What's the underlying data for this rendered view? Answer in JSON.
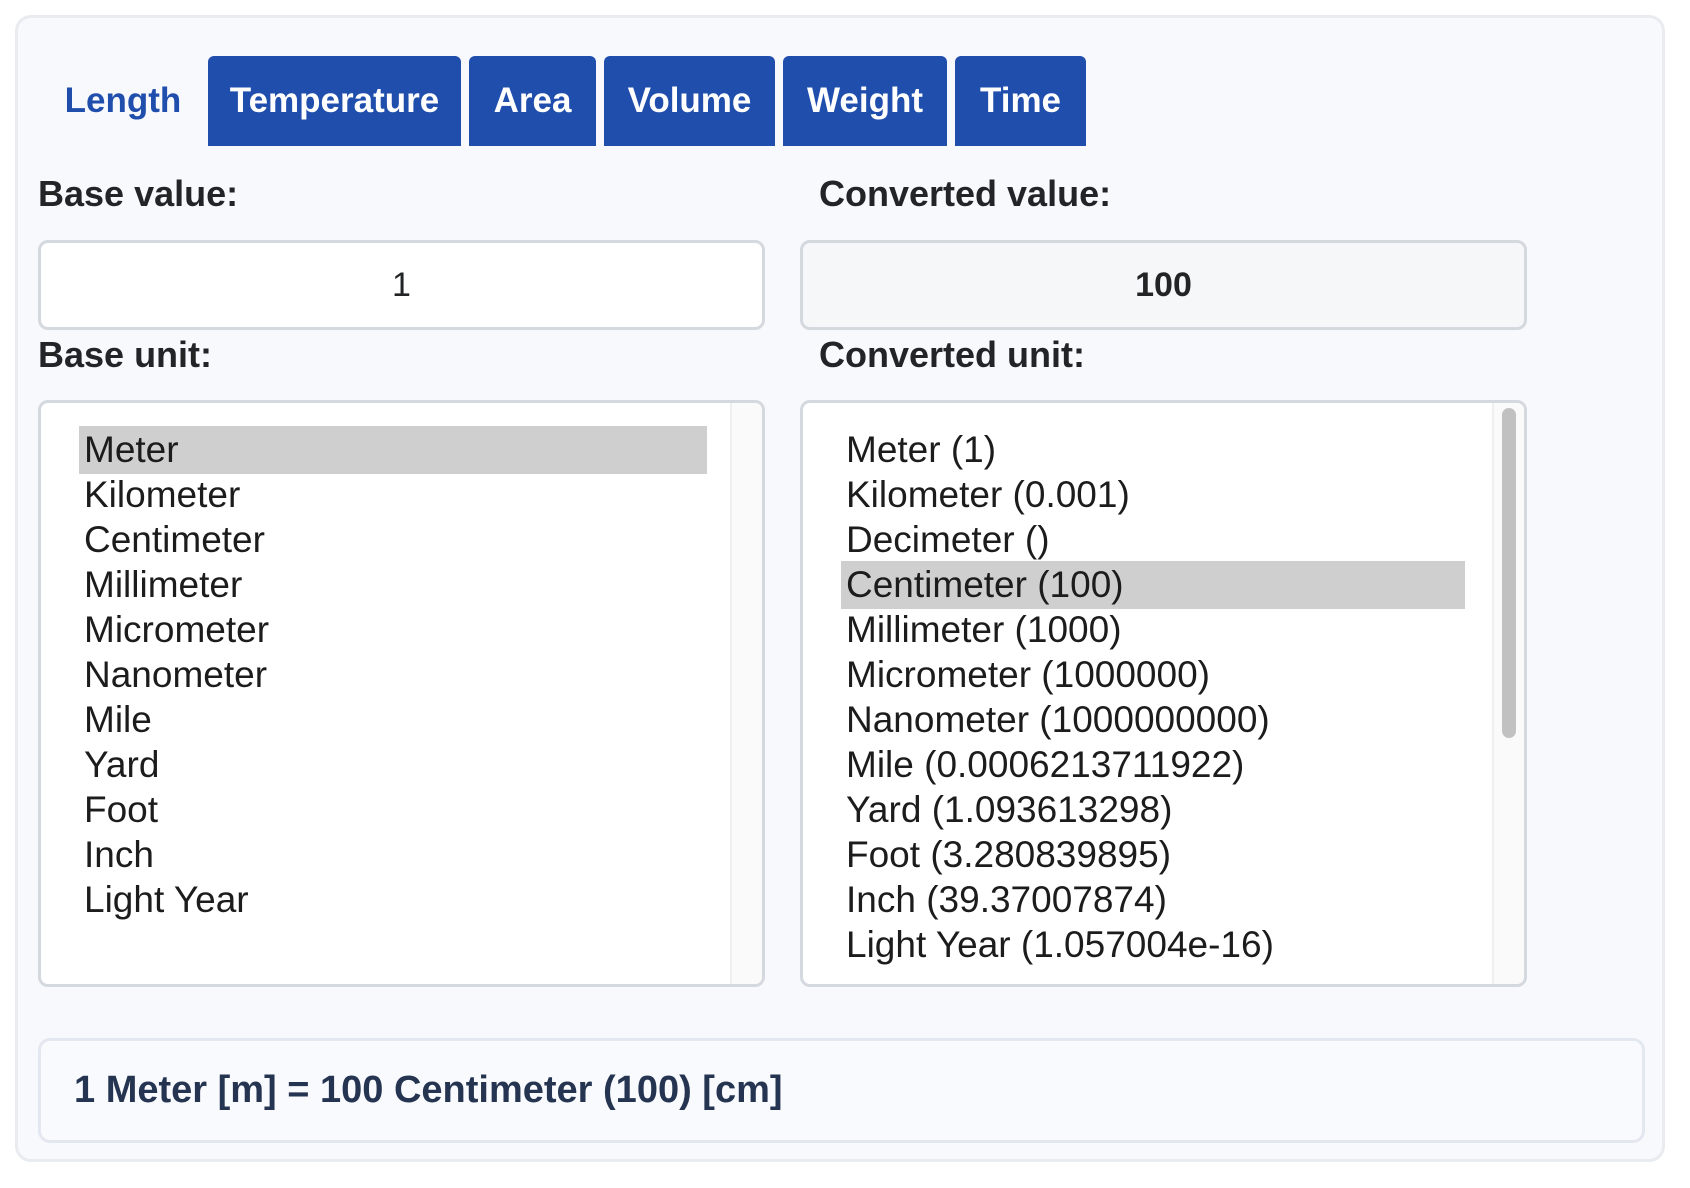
{
  "tabs": [
    {
      "label": "Length",
      "active": true
    },
    {
      "label": "Temperature",
      "active": false
    },
    {
      "label": "Area",
      "active": false
    },
    {
      "label": "Volume",
      "active": false
    },
    {
      "label": "Weight",
      "active": false
    },
    {
      "label": "Time",
      "active": false
    }
  ],
  "base": {
    "value_label": "Base value:",
    "value": "1",
    "unit_label": "Base unit:",
    "units": [
      "Meter",
      "Kilometer",
      "Centimeter",
      "Millimeter",
      "Micrometer",
      "Nanometer",
      "Mile",
      "Yard",
      "Foot",
      "Inch",
      "Light Year"
    ],
    "selected_unit": "Meter"
  },
  "converted": {
    "value_label": "Converted value:",
    "value": "100",
    "unit_label": "Converted unit:",
    "units": [
      "Meter (1)",
      "Kilometer (0.001)",
      "Decimeter ()",
      "Centimeter (100)",
      "Millimeter (1000)",
      "Micrometer (1000000)",
      "Nanometer (1000000000)",
      "Mile (0.0006213711922)",
      "Yard (1.093613298)",
      "Foot (3.280839895)",
      "Inch (39.37007874)",
      "Light Year (1.057004e-16)"
    ],
    "selected_unit": "Centimeter (100)"
  },
  "result": "1 Meter [m] = 100 Centimeter (100) [cm]",
  "colors": {
    "accent": "#1f4ead",
    "selected_option": "#cfcfcf",
    "result_text": "#253450"
  }
}
